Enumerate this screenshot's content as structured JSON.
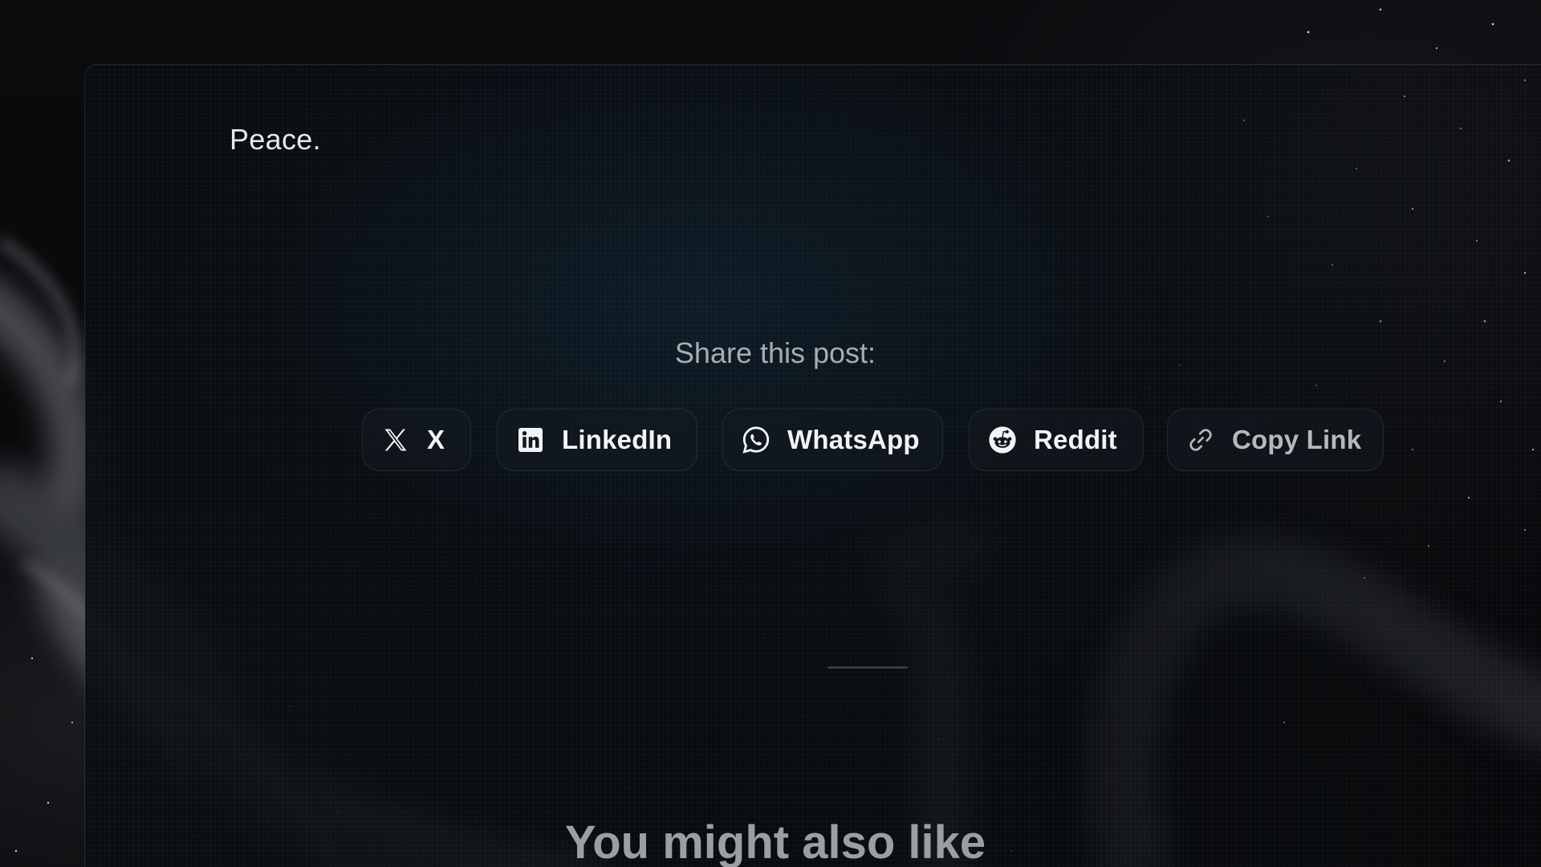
{
  "post": {
    "closing_text": "Peace."
  },
  "share": {
    "heading": "Share this post:",
    "buttons": [
      {
        "label": "X",
        "icon": "x-logo-icon"
      },
      {
        "label": "LinkedIn",
        "icon": "linkedin-icon"
      },
      {
        "label": "WhatsApp",
        "icon": "whatsapp-icon"
      },
      {
        "label": "Reddit",
        "icon": "reddit-icon"
      },
      {
        "label": "Copy Link",
        "icon": "link-icon"
      }
    ]
  },
  "related": {
    "heading": "You might also like"
  },
  "colors": {
    "background": "#070809",
    "card_tint": "#0e202c",
    "text_primary": "#f2f3f5",
    "text_muted": "#a9acb0"
  }
}
